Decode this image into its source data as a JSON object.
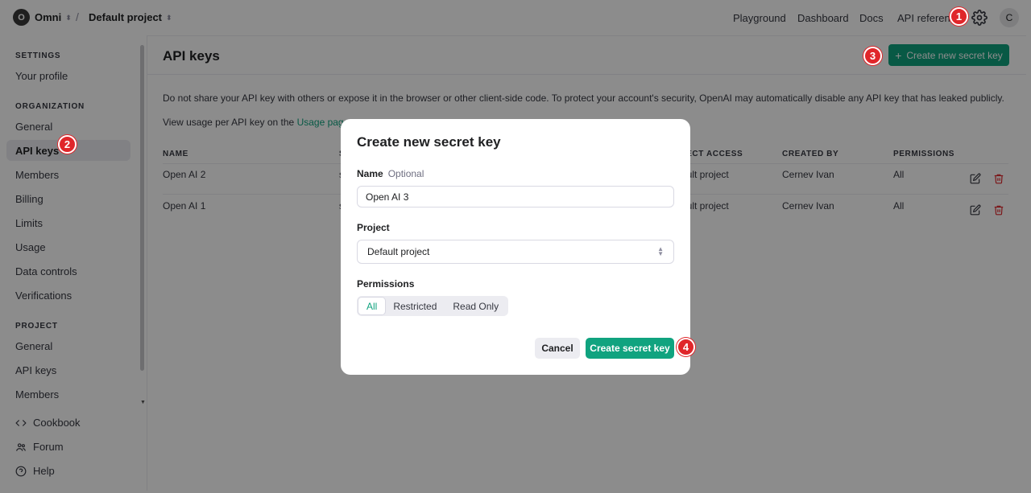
{
  "topbar": {
    "org_avatar": "O",
    "org_name": "Omni",
    "separator": "/",
    "project_name": "Default project",
    "nav": [
      "Playground",
      "Dashboard",
      "Docs",
      "API reference"
    ],
    "user_avatar": "C"
  },
  "sidebar": {
    "settings_heading": "SETTINGS",
    "your_profile": "Your profile",
    "organization_heading": "ORGANIZATION",
    "org_items": [
      "General",
      "API keys",
      "Members",
      "Billing",
      "Limits",
      "Usage",
      "Data controls",
      "Verifications"
    ],
    "project_heading": "PROJECT",
    "project_items": [
      "General",
      "API keys",
      "Members"
    ],
    "footer": [
      "Cookbook",
      "Forum",
      "Help"
    ],
    "active_item": "API keys"
  },
  "main": {
    "title": "API keys",
    "create_button": "Create new secret key",
    "description": "Do not share your API key with others or expose it in the browser or other client-side code. To protect your account's security, OpenAI may automatically disable any API key that has leaked publicly.",
    "usage_prefix": "View usage per API key on the ",
    "usage_link": "Usage page.",
    "table": {
      "headers": [
        "NAME",
        "S",
        "JECT ACCESS",
        "CREATED BY",
        "PERMISSIONS"
      ],
      "rows": [
        {
          "name": "Open AI 2",
          "secret": "s",
          "access": "ault project",
          "created_by": "Cernev Ivan",
          "permissions": "All"
        },
        {
          "name": "Open AI 1",
          "secret": "s",
          "access": "ault project",
          "created_by": "Cernev Ivan",
          "permissions": "All"
        }
      ]
    }
  },
  "modal": {
    "title": "Create new secret key",
    "name_label": "Name",
    "name_optional": "Optional",
    "name_value": "Open AI 3",
    "project_label": "Project",
    "project_value": "Default project",
    "permissions_label": "Permissions",
    "permissions_options": [
      "All",
      "Restricted",
      "Read Only"
    ],
    "permissions_selected": "All",
    "cancel": "Cancel",
    "create": "Create secret key"
  },
  "badges": [
    "1",
    "2",
    "3",
    "4"
  ],
  "colors": {
    "accent": "#10a37f",
    "badge": "#e0262a",
    "overlay": "rgba(0,0,0,0.45)"
  }
}
